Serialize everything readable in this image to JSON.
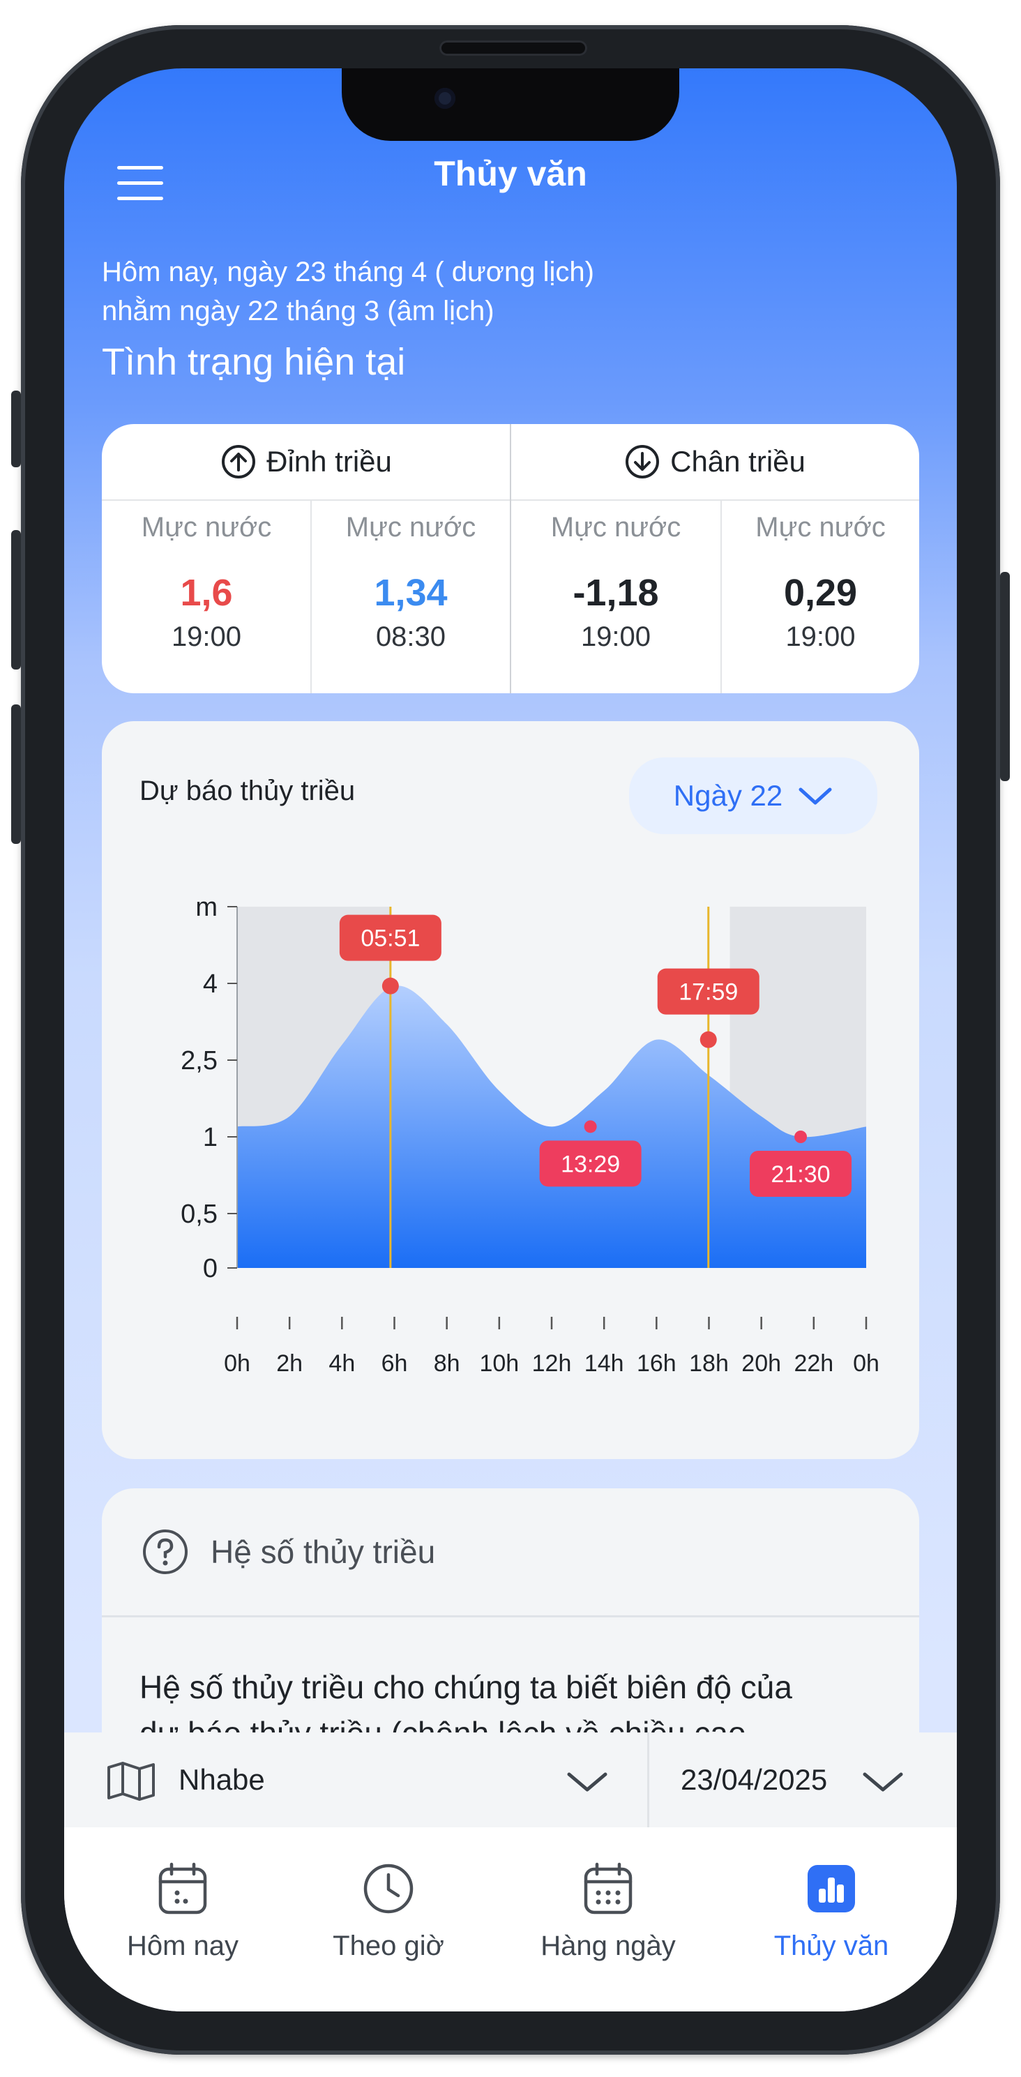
{
  "header": {
    "title": "Thủy văn"
  },
  "date": {
    "solar": "Hôm nay, ngày 23 tháng 4 ( dương lịch)",
    "lunar": "nhằm ngày 22 tháng 3 (âm lịch)"
  },
  "status_title": "Tình trạng hiện tại",
  "tide_table": {
    "high_label": "Đỉnh triều",
    "low_label": "Chân triều",
    "cells": [
      {
        "label": "Mực nước",
        "value": "1,6",
        "time": "19:00",
        "color": "#e84a4a"
      },
      {
        "label": "Mực nước",
        "value": "1,34",
        "time": "08:30",
        "color": "#3b8bf0"
      },
      {
        "label": "Mực nước",
        "value": "-1,18",
        "time": "19:00",
        "color": "#1f2328"
      },
      {
        "label": "Mực nước",
        "value": "0,29",
        "time": "19:00",
        "color": "#1f2328"
      }
    ]
  },
  "forecast": {
    "title": "Dự báo thủy triều",
    "day_select": "Ngày 22"
  },
  "chart_data": {
    "type": "area",
    "y_ticks": [
      "m",
      "4",
      "2,5",
      "1",
      "0,5",
      "0"
    ],
    "x_ticks": [
      "0h",
      "2h",
      "4h",
      "6h",
      "8h",
      "10h",
      "12h",
      "14h",
      "16h",
      "18h",
      "20h",
      "22h",
      "0h"
    ],
    "series": [
      {
        "x": [
          0,
          2,
          4,
          6,
          8,
          10,
          12,
          14,
          16,
          18,
          20,
          21.5,
          24
        ],
        "y": [
          1.2,
          1.4,
          2.8,
          3.95,
          3.2,
          1.9,
          1.2,
          1.9,
          2.9,
          2.2,
          1.4,
          1.0,
          1.2
        ]
      }
    ],
    "markers": [
      {
        "time": "05:51",
        "x": 5.85,
        "y": 3.95,
        "color": "#e84a4a",
        "line": true,
        "label_pos": "above"
      },
      {
        "time": "13:29",
        "x": 13.48,
        "y": 1.2,
        "color": "#ee3d5e",
        "line": false,
        "label_pos": "below"
      },
      {
        "time": "17:59",
        "x": 17.98,
        "y": 2.9,
        "color": "#e84a4a",
        "line": true,
        "label_pos": "above"
      },
      {
        "time": "21:30",
        "x": 21.5,
        "y": 1.0,
        "color": "#ee3d5e",
        "line": false,
        "label_pos": "below"
      }
    ],
    "gradient": [
      "#b4cffe",
      "#1b6ef5"
    ],
    "night_shade_color": "#e2e4e8"
  },
  "coefficient": {
    "title": "Hệ số thủy triều",
    "text_line1": "Hệ số thủy triều cho chúng ta biết biên độ của",
    "text_line2": "dự báo thủy triều (chênh lệch về chiều cao"
  },
  "location": {
    "name": "Nhabe",
    "date": "23/04/2025"
  },
  "tabs": [
    {
      "label": "Hôm nay",
      "active": false
    },
    {
      "label": "Theo giờ",
      "active": false
    },
    {
      "label": "Hàng ngày",
      "active": false
    },
    {
      "label": "Thủy văn",
      "active": true
    }
  ],
  "colors": {
    "accent": "#2f6ff5",
    "header_blue": "#3479fb"
  }
}
